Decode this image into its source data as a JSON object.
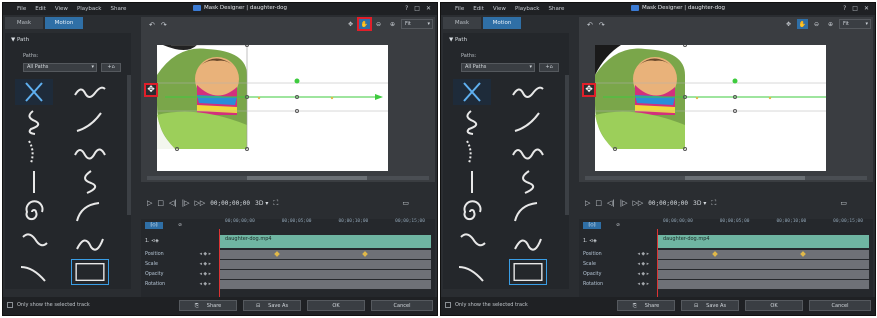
{
  "window": {
    "menu": [
      "File",
      "Edit",
      "View",
      "Playback",
      "Share"
    ],
    "title": "Mask Designer | daughter-dog",
    "controls": [
      "?",
      "□",
      "✕"
    ]
  },
  "tabs": [
    "Mask",
    "Motion"
  ],
  "left_panel": {
    "section": "▼ Path",
    "paths_label": "Paths:",
    "paths_select": "All Paths",
    "paths_select_chevron": "▾",
    "paths_button": "+⌂"
  },
  "preview": {
    "fit_select": "Fit",
    "fit_chevron": "▾",
    "tool_move": "✥",
    "tool_hand": "✋",
    "tool_zoom_out": "⊖",
    "tool_zoom_in": "⊕",
    "undo": "↶",
    "redo": "↷",
    "move_handle": "✥"
  },
  "playback": {
    "play": "▷",
    "stop": "□",
    "prev_frame": "◁|",
    "next_frame": "|▷",
    "fast_forward": "▷▷",
    "timecode": "00;00;00;00",
    "mode": "3D ▾",
    "fullscreen": "⛶",
    "screen": "▭"
  },
  "timeline": {
    "tool_active": "[◇]",
    "tool_other": "⊘",
    "ruler": [
      "00;00;00;00",
      "00;00;05;00",
      "00;00;10;00",
      "00;00;15;00"
    ],
    "clip_track_name": "1. ⊲◈",
    "clip_name": "daughter-dog.mp4",
    "tracks": [
      {
        "name": "Position",
        "kf": "◂ ◆ ▸"
      },
      {
        "name": "Scale",
        "kf": "◂ ◆ ▸"
      },
      {
        "name": "Opacity",
        "kf": "◂ ◆ ▸"
      },
      {
        "name": "Rotation",
        "kf": "◂ ◆ ▸"
      }
    ]
  },
  "footer": {
    "only_show_label": "Only show the selected track",
    "share_icon": "⎘",
    "share": "Share",
    "saveas_icon": "⊟",
    "save_as": "Save As",
    "ok": "OK",
    "cancel": "Cancel"
  },
  "colors": {
    "accent": "#2f6fa6",
    "highlight": "#e01f2a",
    "motion_path": "#3ecb3e",
    "clip": "#6fb5a2",
    "keyframe": "#e0b94a"
  }
}
